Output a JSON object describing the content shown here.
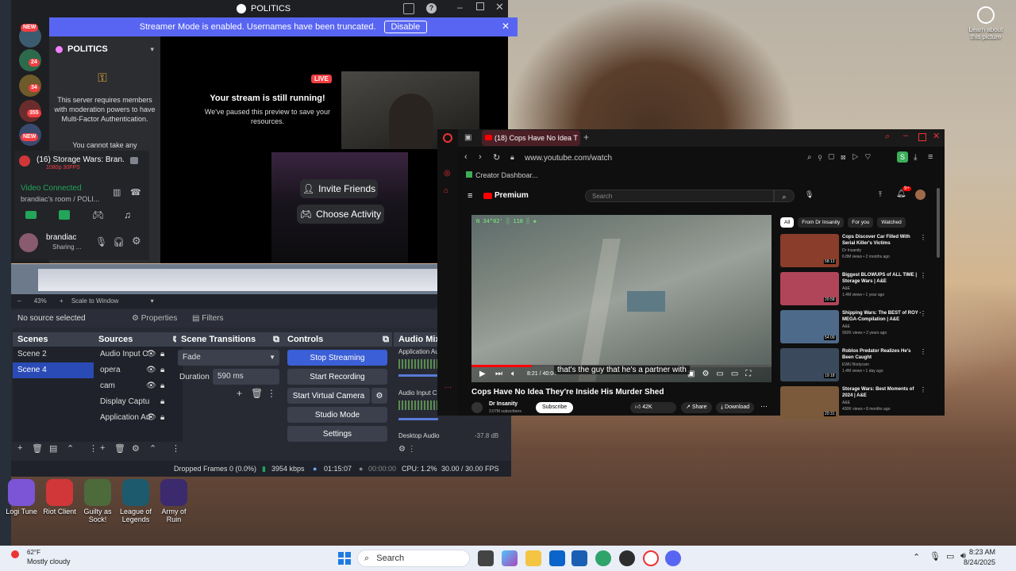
{
  "discord": {
    "window_title": "POLITICS",
    "banner_text": "Streamer Mode is enabled. Usernames have been truncated.",
    "banner_button": "Disable",
    "server_name": "POLITICS",
    "mfa_text": "This server requires members with moderation powers to have Multi-Factor Authentication.",
    "cannot_text": "You cannot take any",
    "servers": [
      {
        "badge": "NEW"
      },
      {
        "badge": "24"
      },
      {
        "badge": "34"
      },
      {
        "badge": "355"
      },
      {
        "badge": "NEW"
      }
    ],
    "stream_title": "(16) Storage Wars: Bran...",
    "stream_quality": "1080p 30FPS",
    "voice_status": "Video Connected",
    "voice_room": "brandiac's room / POLI...",
    "user_name": "brandiac",
    "user_status": "Sharing ...",
    "live_badge": "LIVE",
    "stream_running_title": "Your stream is still running!",
    "stream_running_sub": "We've paused this preview to save your resources.",
    "invite_button": "Invite Friends",
    "activity_button": "Choose Activity"
  },
  "obs": {
    "zoom": "43%",
    "scale_label": "Scale to Window",
    "no_source": "No source selected",
    "properties_btn": "Properties",
    "filters_btn": "Filters",
    "scenes_title": "Scenes",
    "scenes": [
      "Scene 2",
      "Scene 4"
    ],
    "selected_scene": "Scene 4",
    "sources_title": "Sources",
    "sources": [
      "Audio Input C",
      "opera",
      "cam",
      "Display Captu",
      "Application Au"
    ],
    "transitions_title": "Scene Transitions",
    "transition": "Fade",
    "duration_label": "Duration",
    "duration_value": "590 ms",
    "controls_title": "Controls",
    "controls": [
      "Stop Streaming",
      "Start Recording",
      "Start Virtual Camera",
      "Studio Mode",
      "Settings"
    ],
    "mixer_title": "Audio Mixer",
    "mixer_items": [
      "Application Au",
      "Audio Input C",
      "Desktop Audio"
    ],
    "mixer_db": "-37.8 dB",
    "status": {
      "dropped": "Dropped Frames 0 (0.0%)",
      "kbps": "3954 kbps",
      "stream_time": "01:15:07",
      "rec_time": "00:00:00",
      "cpu": "CPU: 1.2%",
      "fps": "30.00 / 30.00 FPS"
    }
  },
  "browser": {
    "tab_title": "(18) Cops Have No Idea T",
    "url": "www.youtube.com/watch",
    "bookmark": "Creator Dashboar...",
    "profile_letter": "S",
    "yt_brand": "Premium",
    "search_placeholder": "Search",
    "notif_count": "9+",
    "video_title": "Cops Have No Idea They're Inside His Murder Shed",
    "video_caption": "that's the guy that he's a partner with",
    "video_time": "8:21 / 40:04",
    "channel": "Dr Insanity",
    "subscribers": "3.07M subscribers",
    "subscribe_btn": "Subscribe",
    "likes": "42K",
    "share": "Share",
    "download": "Download",
    "chips": [
      "All",
      "From Dr Insanity",
      "For you",
      "Watched"
    ],
    "related": [
      {
        "title": "Cops Discover Car Filled With Serial Killer's Victims",
        "channel": "Dr Insanity",
        "meta": "6.8M views • 2 months ago",
        "duration": "58:13",
        "color": "#8a3d2a"
      },
      {
        "title": "Biggest BLOWUPS of ALL TIME | Storage Wars | A&E",
        "channel": "A&E",
        "meta": "1.4M views • 1 year ago",
        "duration": "20:58",
        "color": "#b0455a"
      },
      {
        "title": "Shipping Wars: The BEST of ROY - MEGA-Compilation | A&E",
        "channel": "A&E",
        "meta": "992K views • 2 years ago",
        "duration": "54:09",
        "color": "#4d6a8a"
      },
      {
        "title": "Roblox Predator Realizes He's Been Caught",
        "channel": "EWU Bodycam",
        "meta": "1.4M views • 1 day ago",
        "duration": "19:18",
        "color": "#3a4a5c"
      },
      {
        "title": "Storage Wars: Best Moments of 2024 | A&E",
        "channel": "A&E",
        "meta": "430K views • 8 months ago",
        "duration": "20:31",
        "color": "#7a5a3a"
      }
    ]
  },
  "desktop": {
    "top_right_label": "Learn about this picture",
    "icons": [
      {
        "label": "Logi Tune",
        "color": "#7b55d6"
      },
      {
        "label": "Riot Client",
        "color": "#d13639"
      },
      {
        "label": "Guilty as Sock!",
        "color": "#4c6a3a"
      },
      {
        "label": "League of Legends",
        "color": "#1d5a6e"
      },
      {
        "label": "Army of Ruin",
        "color": "#3c2a6e"
      }
    ]
  },
  "taskbar": {
    "weather_temp": "62°F",
    "weather_desc": "Mostly cloudy",
    "search_label": "Search",
    "time": "8:23 AM",
    "date": "8/24/2025"
  }
}
